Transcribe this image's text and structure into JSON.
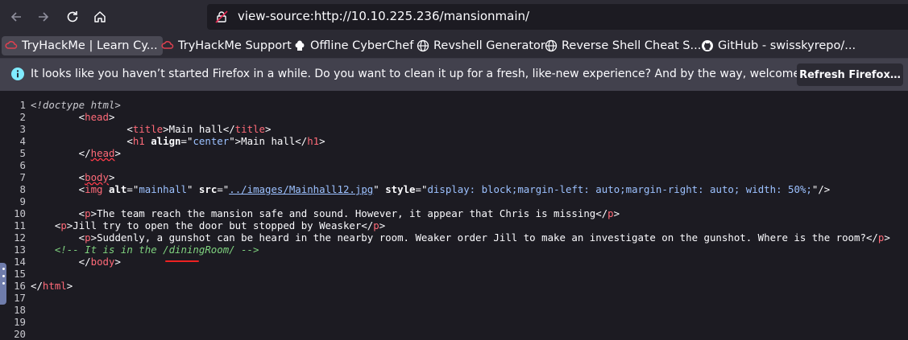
{
  "browser": {
    "url": "view-source:http://10.10.225.236/mansionmain/"
  },
  "bookmarks": [
    {
      "label": "TryHackMe | Learn Cy...",
      "icon": "tryhackme-icon"
    },
    {
      "label": "TryHackMe Support",
      "icon": "tryhackme-icon"
    },
    {
      "label": "Offline CyberChef",
      "icon": "chef-hat-icon"
    },
    {
      "label": "Revshell Generator",
      "icon": "globe-icon"
    },
    {
      "label": "Reverse Shell Cheat S...",
      "icon": "globe-icon"
    },
    {
      "label": "GitHub - swisskyrepo/...",
      "icon": "github-icon"
    }
  ],
  "notification": {
    "message": "It looks like you haven’t started Firefox in a while. Do you want to clean it up for a fresh, like-new experience? And by the way, welcome back!",
    "button": "Refresh Firefox…"
  },
  "source": {
    "line_numbers": [
      "1",
      "2",
      "3",
      "4",
      "5",
      "6",
      "7",
      "8",
      "9",
      "10",
      "11",
      "12",
      "13",
      "14",
      "15",
      "16",
      "17",
      "18",
      "19",
      "20"
    ],
    "l1": "<!doctype html>",
    "l3_title": "Main hall",
    "l4_h1_value": "center",
    "l4_h1_text": "Main hall",
    "l8_alt": "mainhall",
    "l8_src": "../images/Mainhall12.jpg",
    "l8_style": "display: block;margin-left: auto;margin-right: auto; width: 50%;",
    "l10_text": "The team reach the mansion safe and sound. However, it appear that Chris is missing",
    "l11_text": "Jill try to open the door but stopped by Weasker",
    "l12_text": "Suddenly, a gunshot can be heard in the nearby room. Weaker order Jill to make an investigate on the gunshot. Where is the room?",
    "l13_comment": "<!-- It is in the /diningRoom/ -->"
  }
}
